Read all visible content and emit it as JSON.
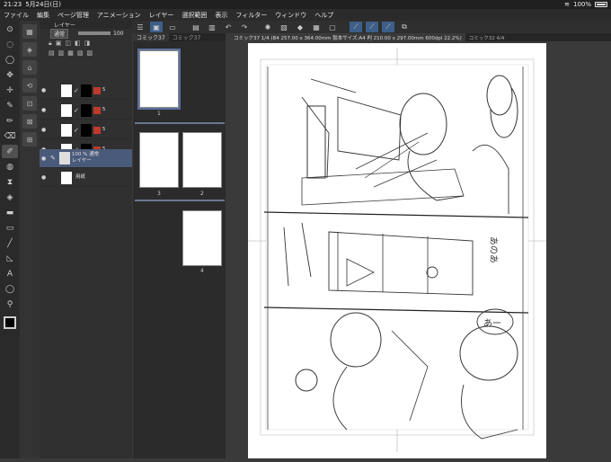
{
  "status": {
    "time": "21:23",
    "date": "5月24日(日)",
    "battery": "100%"
  },
  "menu": [
    "ファイル",
    "編集",
    "ページ管理",
    "アニメーション",
    "レイヤー",
    "選択範囲",
    "表示",
    "フィルター",
    "ウィンドウ",
    "ヘルプ"
  ],
  "layer_panel": {
    "title": "レイヤー",
    "blend": "通常",
    "opacity_value": "100",
    "layers": [
      {
        "kind": "frame",
        "check": "✓",
        "mask_text": "5"
      },
      {
        "kind": "frame",
        "check": "✓",
        "mask_text": "5"
      },
      {
        "kind": "frame",
        "check": "✓",
        "mask_text": "5"
      },
      {
        "kind": "frame",
        "check": "✓",
        "mask_text": "5"
      },
      {
        "kind": "raster",
        "line1": "100 % 通常",
        "line2": "レイヤー"
      },
      {
        "kind": "paper",
        "line1": "用紙"
      }
    ]
  },
  "page_panel": {
    "tabs": [
      "コミック37",
      "コミック37"
    ],
    "page_labels": [
      "1",
      "3",
      "2",
      "4"
    ]
  },
  "doc_tabs": [
    {
      "label": "コミック37 1/4 (B4 257.00 x 364.00mm 製本サイズ:A4 判 210.00 x 297.00mm 600dpi 22.2%)",
      "active": true
    },
    {
      "label": "コミック32 4/4",
      "active": false
    }
  ],
  "icons": {
    "status_right": [
      "wifi-icon",
      "battery-icon"
    ],
    "toolbar": [
      "menu-icon",
      "window-icon",
      "new-icon",
      "open-icon",
      "save-icon",
      "undo-icon",
      "redo-icon",
      "settings-icon",
      "cut-icon",
      "copy-icon",
      "paste-icon",
      "select-icon",
      "pen-icon",
      "pen2-icon",
      "transform-icon"
    ],
    "tools": [
      "zoom-icon",
      "lasso-icon",
      "select-icon",
      "move-icon",
      "transform-icon",
      "brush-icon",
      "pen-icon",
      "eraser-icon",
      "fill-icon",
      "line-icon",
      "text-icon",
      "balloon-icon",
      "eyedropper-icon"
    ]
  }
}
